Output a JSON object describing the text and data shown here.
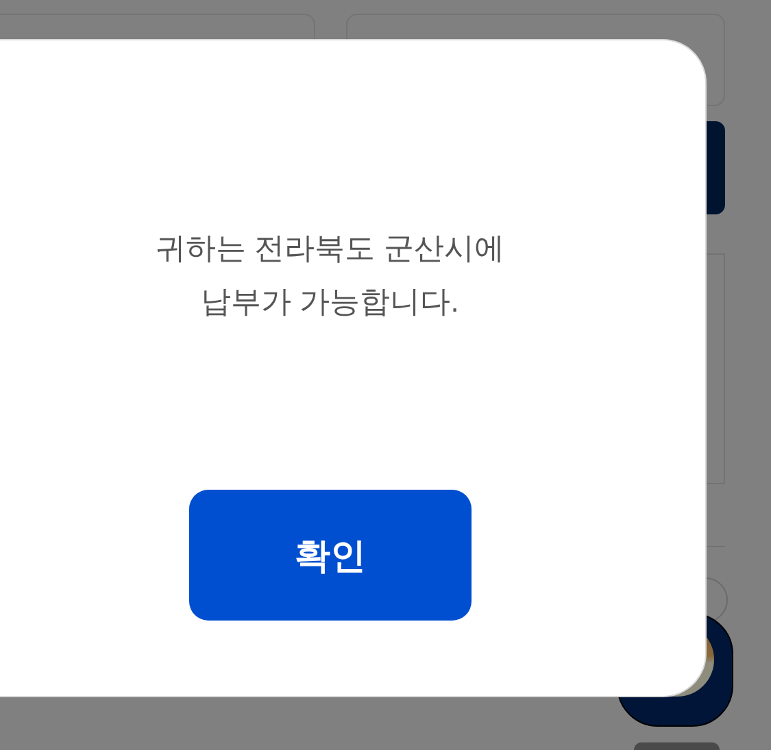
{
  "dialog": {
    "message_lines": [
      "귀하는 전라북도 군산시에",
      "납부가 가능합니다."
    ],
    "confirm_button": {
      "label": "확인"
    }
  }
}
